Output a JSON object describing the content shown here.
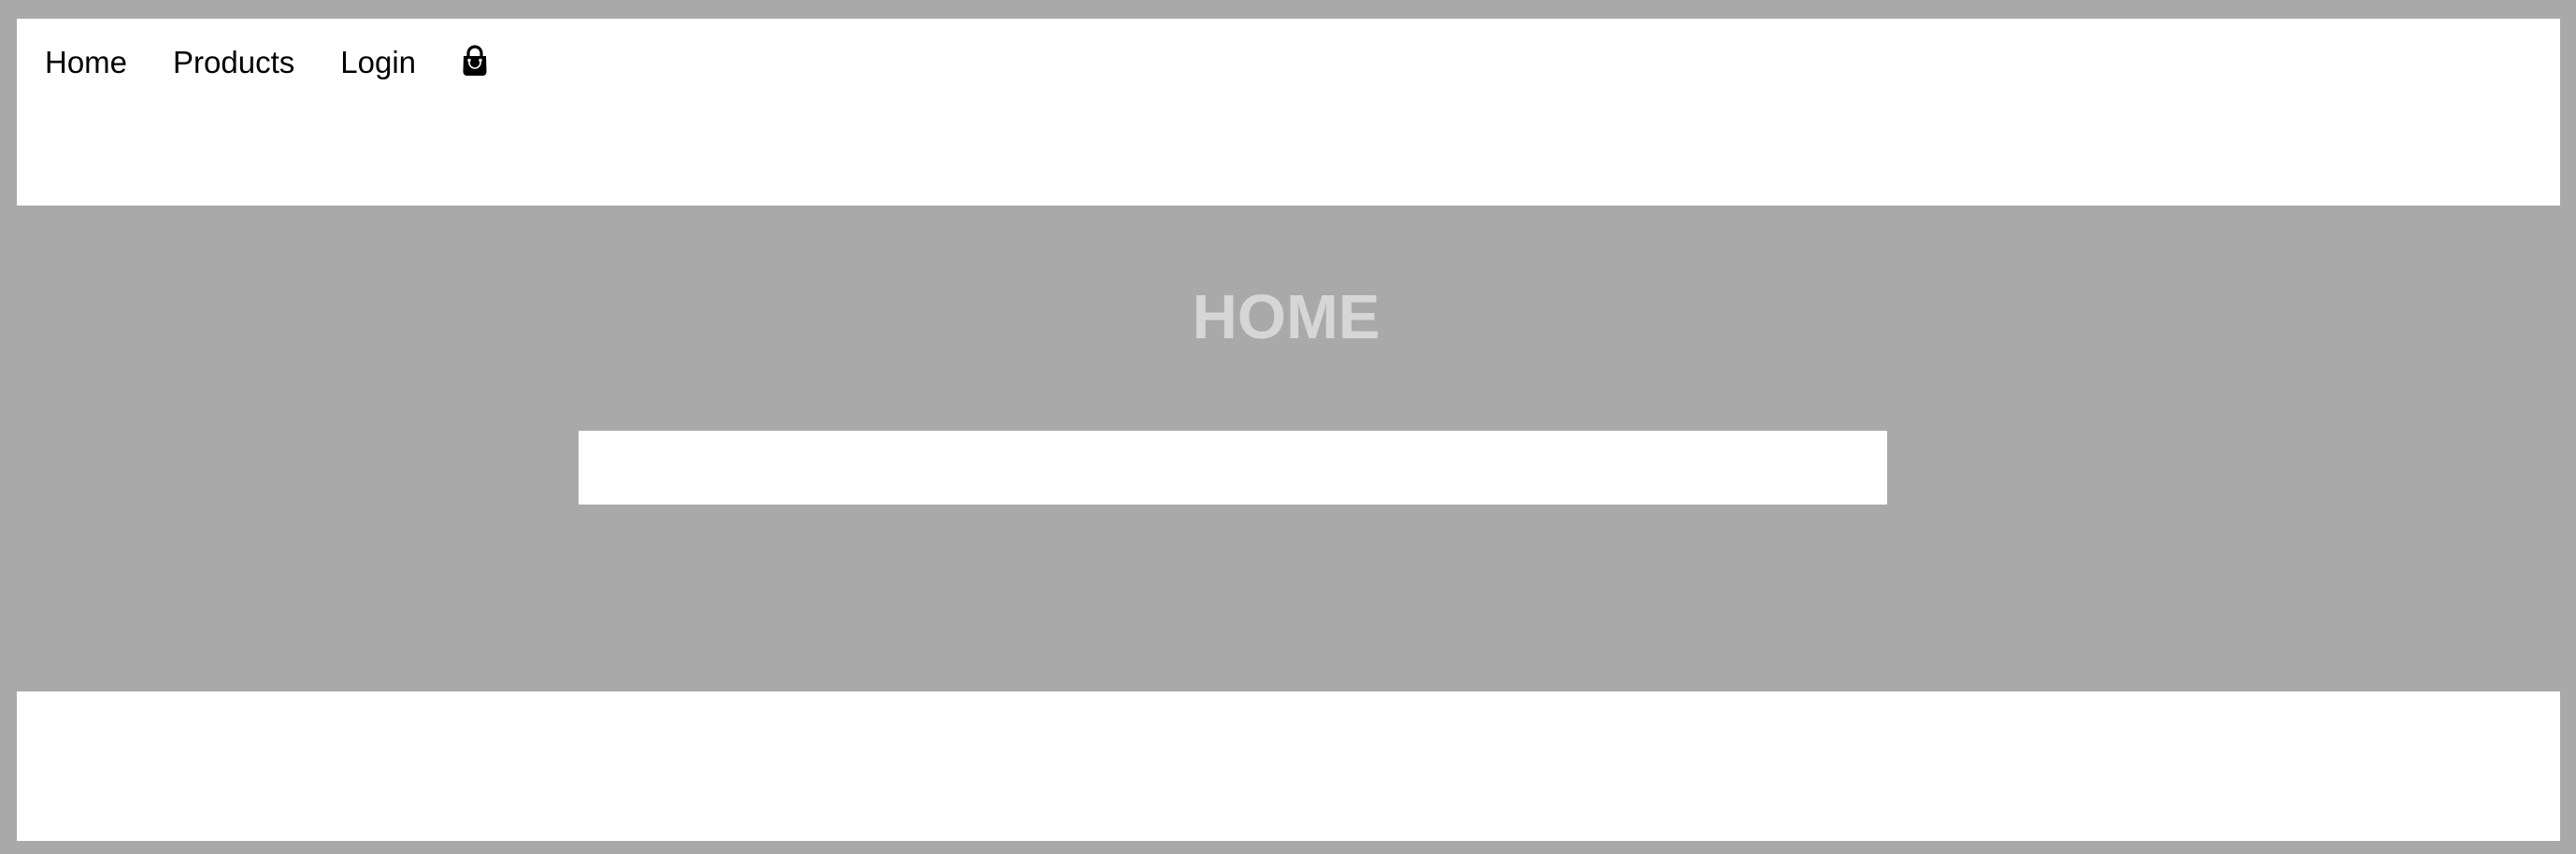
{
  "nav": {
    "items": [
      {
        "label": "Home"
      },
      {
        "label": "Products"
      },
      {
        "label": "Login"
      }
    ],
    "cart_icon": "shopping-bag-icon"
  },
  "main": {
    "title": "HOME",
    "search": {
      "value": "",
      "placeholder": ""
    }
  },
  "colors": {
    "page_background": "#a9a9a9",
    "panel_background": "#ffffff",
    "title_color": "#d6d6d6",
    "nav_text": "#000000"
  }
}
